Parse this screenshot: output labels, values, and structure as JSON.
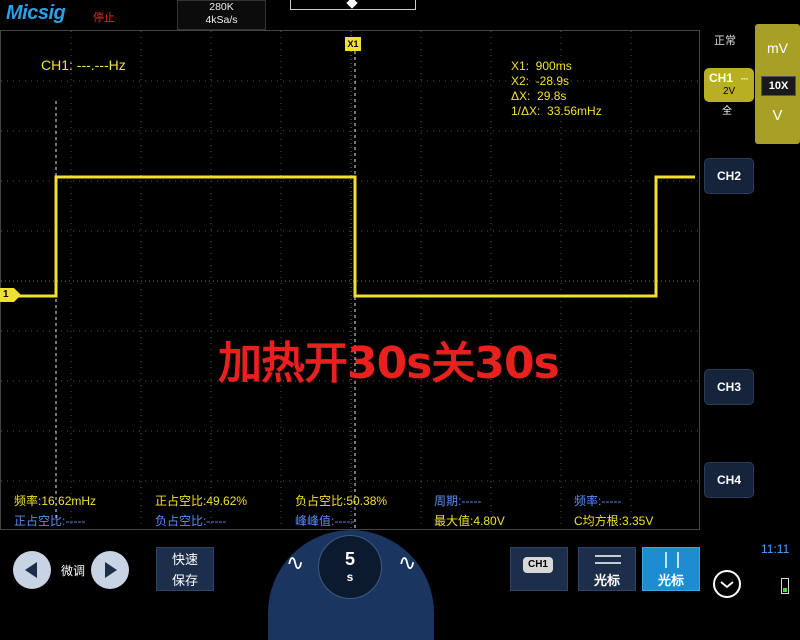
{
  "header": {
    "logo": "Micsig",
    "run_status": "停止",
    "memory_depth": "280K",
    "sample_rate": "4kSa/s"
  },
  "display": {
    "ch1_frequency": "CH1: ---.---Hz",
    "x1_marker": "X1",
    "channel_marker": "1",
    "overlay_text": "加热开30s关30s",
    "cursors": {
      "x1": "X1:  900ms",
      "x2": "X2:  -28.9s",
      "dx": "ΔX:  29.8s",
      "inv_dx": "1/ΔX:  33.56mHz"
    },
    "waveform_levels": {
      "high": "on",
      "low": "off"
    }
  },
  "measurements": {
    "row1": [
      "频率:16.62mHz",
      "正占空比:49.62%",
      "负占空比:50.38%",
      "周期:-----",
      "频率:-----"
    ],
    "row2": [
      "正占空比:-----",
      "负占空比:-----",
      "峰峰值:-----",
      "最大值:4.80V",
      "C均方根:3.35V"
    ]
  },
  "right_panel": {
    "trigger_mode": "正常",
    "ch1": {
      "label": "CH1",
      "scale": "2V",
      "coupling": "全"
    },
    "ch2": "CH2",
    "ch3": "CH3",
    "ch4": "CH4",
    "scale": {
      "up_unit": "mV",
      "probe": "10X",
      "down_unit": "V"
    }
  },
  "bottom_bar": {
    "fine_tune": "微调",
    "horizontal_save": [
      "快速",
      "保存"
    ],
    "timebase_value": "5",
    "timebase_unit": "s",
    "ch1_select": "CH1",
    "cursor_label_1": "光标",
    "cursor_label_2": "光标",
    "clock": "11:11"
  },
  "colors": {
    "trace": "#f0e030",
    "overlay": "#e8201e",
    "accent": "#1e8cd0"
  }
}
